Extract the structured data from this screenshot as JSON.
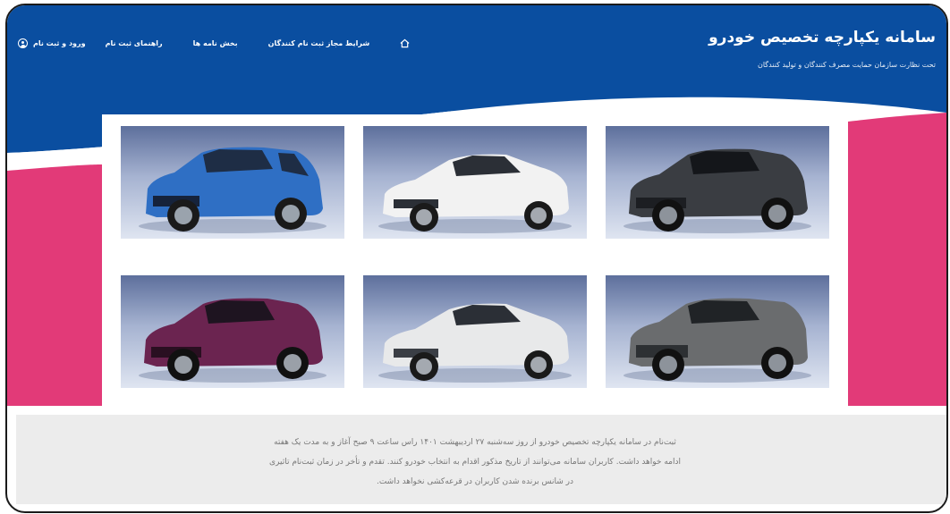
{
  "header": {
    "title": "سامانه یکپارچه تخصیص خودرو",
    "subtitle": "تحت نظارت سازمان حمایت مصرف کنندگان و تولید کنندگان",
    "nav": {
      "home_icon": "home-icon",
      "conditions": "شرایط مجاز ثبت نام کنندگان",
      "circulars": "بخش نامه ها",
      "guide": "راهنمای ثبت نام",
      "login": "ورود و ثبت نام",
      "user_icon": "user-circle-icon"
    }
  },
  "colors": {
    "header_blue": "#0a4ea0",
    "accent_pink": "#e23a78",
    "notice_bg": "#ececec"
  },
  "cars": [
    {
      "color": "#2f6fc4",
      "style": "suv"
    },
    {
      "color": "#f2f2f2",
      "style": "sedan"
    },
    {
      "color": "#3a3d42",
      "style": "suv"
    },
    {
      "color": "#6b2450",
      "style": "suv"
    },
    {
      "color": "#e8e9ea",
      "style": "sedan"
    },
    {
      "color": "#6a6c6e",
      "style": "suv"
    }
  ],
  "notice": {
    "line1": "ثبت‌نام در سامانه یکپارچه تخصیص خودرو از روز سه‌شنبه ۲۷ اردیبهشت ۱۴۰۱ راس ساعت ۹ صبح آغاز و به مدت یک هفته",
    "line2": "ادامه خواهد داشت. کاربران سامانه می‌توانند از تاریخ مذکور اقدام به انتخاب خودرو کنند. تقدم و تأخر در زمان ثبت‌نام تاثیری",
    "line3": "در شانس برنده شدن کاربران در قرعه‌کشی نخواهد داشت."
  }
}
